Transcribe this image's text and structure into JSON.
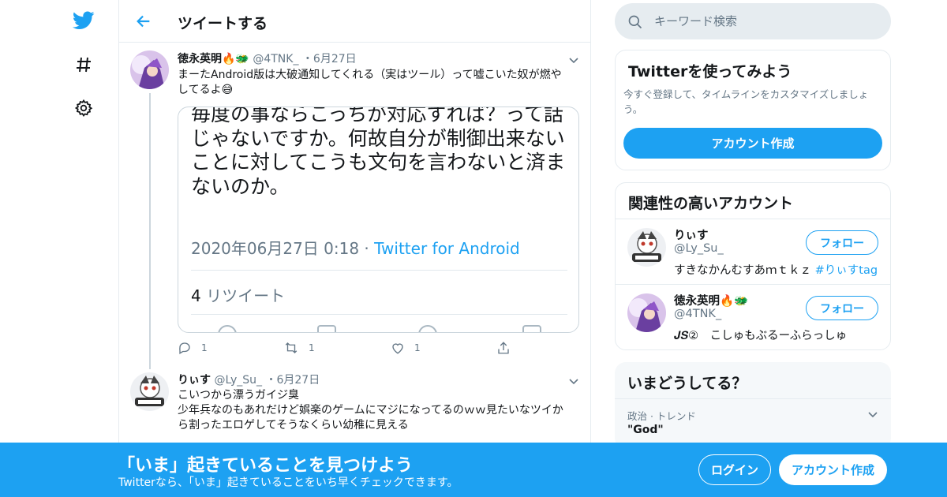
{
  "colors": {
    "brand": "#1da1f2",
    "text": "#14171a",
    "muted": "#657786",
    "border": "#e6ecf0"
  },
  "nav": {
    "icons": [
      "twitter-bird-icon",
      "hashtag-icon",
      "gear-icon"
    ]
  },
  "header": {
    "title": "ツイートする"
  },
  "tweet1": {
    "name": "徳永英明🔥🐲",
    "handle": "@4TNK_",
    "date": "・6月27日",
    "text": "まーたAndroid版は大破通知してくれる（実はツール）って嘘こいた奴が燃やしてるよ😅",
    "media": {
      "text": "毎度の事ならこっちが対応すれば？って話じゃないですか。何故自分が制御出来ないことに対してこうも文句を言わないと済まないのか。",
      "timestamp": "2020年06月27日 0:18 · ",
      "source": "Twitter for Android",
      "retweet_count": "4",
      "retweet_label": " リツイート"
    },
    "actions": {
      "replies": "1",
      "retweets": "1",
      "likes": "1"
    }
  },
  "tweet2": {
    "name": "りぃす",
    "handle": "@Ly_Su_",
    "date": "・6月27日",
    "text": "こいつから漂うガイジ臭\n少年兵なのもあれだけど娯楽のゲームにマジになってるのｗｗ見たいなツイから割ったエロゲしてそうなくらい幼稚に見える"
  },
  "search": {
    "placeholder": "キーワード検索"
  },
  "signup_card": {
    "title": "Twitterを使ってみよう",
    "desc": "今すぐ登録して、タイムラインをカスタマイズしましょう。",
    "button": "アカウント作成"
  },
  "related": {
    "title": "関連性の高いアカウント",
    "accounts": [
      {
        "name": "りぃす",
        "handle": "@Ly_Su_",
        "bio": "すきなかんむすあｍｔｋｚ ",
        "tag": "#りぃすtag",
        "follow": "フォロー"
      },
      {
        "name": "徳永英明🔥🐲",
        "handle": "@4TNK_",
        "bio": "𝑱𝑺②　こしゅもぶるーふらっしゅ",
        "tag": "",
        "follow": "フォロー"
      }
    ]
  },
  "trends": {
    "title": "いまどうしてる？",
    "items": [
      {
        "category": "政治 · トレンド",
        "name": "\"God\""
      }
    ]
  },
  "banner": {
    "title": "「いま」起きていることを見つけよう",
    "subtitle": "Twitterなら、「いま」起きていることをいち早くチェックできます。",
    "login": "ログイン",
    "signup": "アカウント作成"
  }
}
